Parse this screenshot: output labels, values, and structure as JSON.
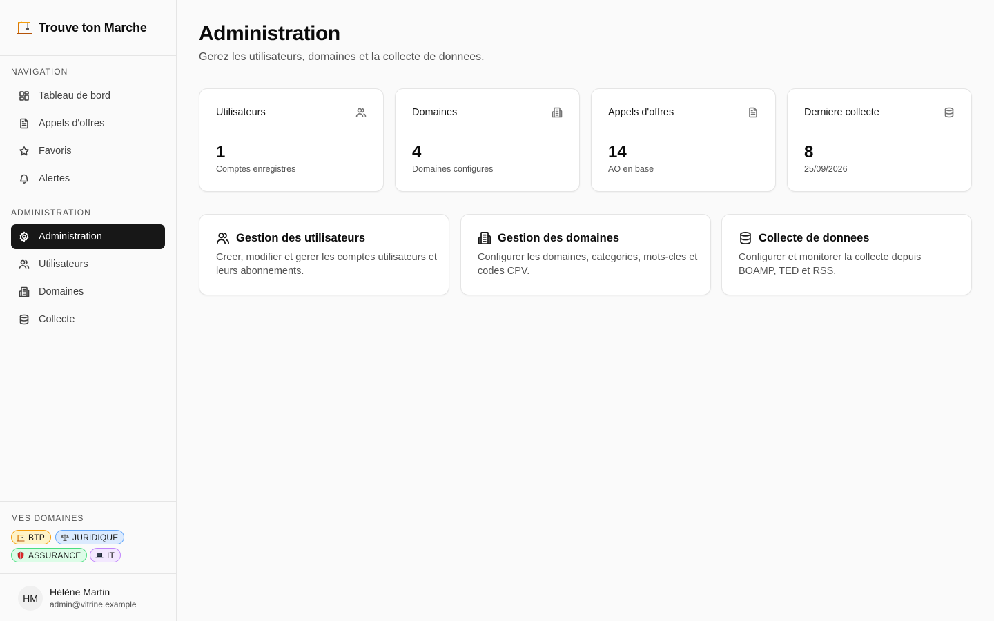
{
  "app": {
    "title": "Trouve ton Marche"
  },
  "sidebar": {
    "nav_section": "NAVIGATION",
    "nav_items": [
      {
        "label": "Tableau de bord",
        "icon": "dashboard-icon"
      },
      {
        "label": "Appels d'offres",
        "icon": "document-icon"
      },
      {
        "label": "Favoris",
        "icon": "star-icon"
      },
      {
        "label": "Alertes",
        "icon": "bell-icon"
      }
    ],
    "admin_section": "ADMINISTRATION",
    "admin_items": [
      {
        "label": "Administration",
        "icon": "gear-icon",
        "active": true
      },
      {
        "label": "Utilisateurs",
        "icon": "users-icon"
      },
      {
        "label": "Domaines",
        "icon": "building-icon"
      },
      {
        "label": "Collecte",
        "icon": "database-icon"
      }
    ],
    "domains_section": "MES DOMAINES",
    "domains": [
      {
        "label": "BTP",
        "icon": "crane-icon",
        "bg": "#fef3c7",
        "border": "#f59e0b"
      },
      {
        "label": "JURIDIQUE",
        "icon": "scales-icon",
        "bg": "#dbeafe",
        "border": "#60a5fa"
      },
      {
        "label": "ASSURANCE",
        "icon": "shield-icon",
        "bg": "#dcfce7",
        "border": "#4ade80"
      },
      {
        "label": "IT",
        "icon": "laptop-icon",
        "bg": "#f3e8ff",
        "border": "#c084fc"
      }
    ],
    "user": {
      "initials": "HM",
      "name": "Hélène Martin",
      "email": "admin@vitrine.example"
    }
  },
  "main": {
    "title": "Administration",
    "subtitle": "Gerez les utilisateurs, domaines et la collecte de donnees.",
    "stats": [
      {
        "label": "Utilisateurs",
        "value": "1",
        "caption": "Comptes enregistres",
        "icon": "users-icon"
      },
      {
        "label": "Domaines",
        "value": "4",
        "caption": "Domaines configures",
        "icon": "building-icon"
      },
      {
        "label": "Appels d'offres",
        "value": "14",
        "caption": "AO en base",
        "icon": "document-icon"
      },
      {
        "label": "Derniere collecte",
        "value": "8",
        "caption": "25/09/2026",
        "icon": "database-icon"
      }
    ],
    "cards": [
      {
        "title": "Gestion des utilisateurs",
        "desc": "Creer, modifier et gerer les comptes utilisateurs et leurs abonnements.",
        "icon": "users-icon"
      },
      {
        "title": "Gestion des domaines",
        "desc": "Configurer les domaines, categories, mots-cles et codes CPV.",
        "icon": "building-icon"
      },
      {
        "title": "Collecte de donnees",
        "desc": "Configurer et monitorer la collecte depuis BOAMP, TED et RSS.",
        "icon": "database-icon"
      }
    ]
  },
  "colors": {
    "active_bg": "#171717",
    "border": "#e5e5e5",
    "muted_text": "#525252",
    "background": "#fafafa"
  }
}
